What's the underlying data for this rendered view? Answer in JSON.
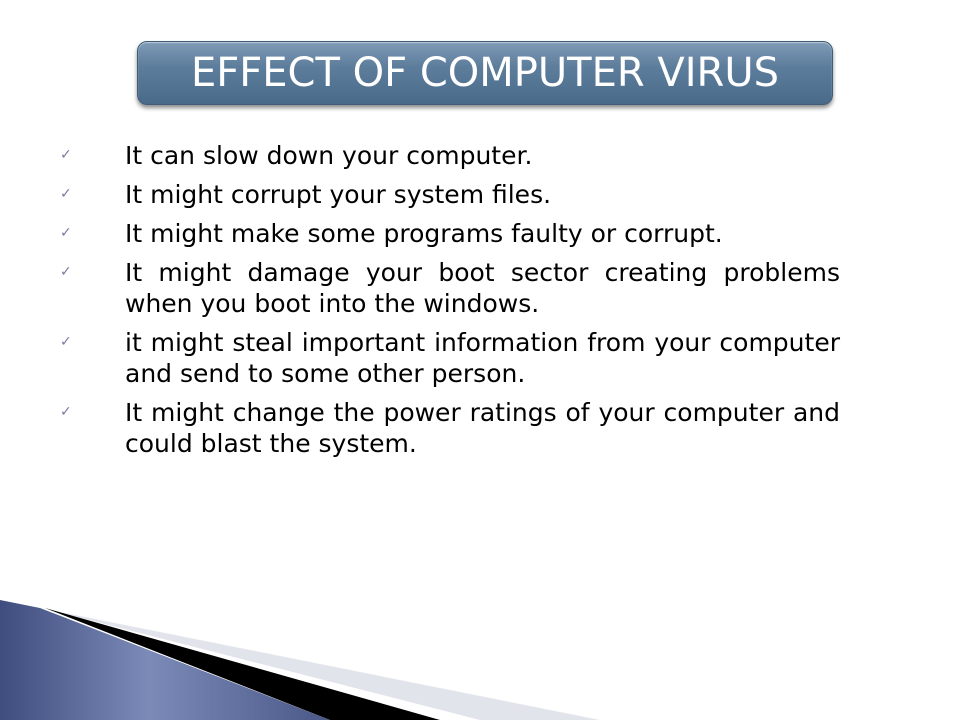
{
  "slide": {
    "title": "EFFECT OF COMPUTER VIRUS",
    "bullet_icon": "checkmark-icon",
    "bullet_glyph": "✓",
    "items": [
      {
        "text": "It can slow down your computer."
      },
      {
        "text": "It might corrupt your system files."
      },
      {
        "text": "It might make some programs faulty or corrupt."
      },
      {
        "text": "It might damage your boot sector creating problems when you boot into the windows."
      },
      {
        "text": "it might steal important information from your computer and send to some other person."
      },
      {
        "text": "It might change the power ratings of your computer and could blast the system."
      }
    ]
  }
}
